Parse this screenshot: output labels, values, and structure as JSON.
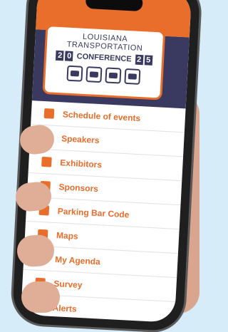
{
  "logo": {
    "title": "LOUISIANA TRANSPORTATION",
    "digits_left": [
      "2",
      "0"
    ],
    "conference": "CONFERENCE",
    "digits_right": [
      "2",
      "5"
    ]
  },
  "menu": [
    {
      "label": "Schedule of events",
      "icon": "calendar-icon"
    },
    {
      "label": "Speakers",
      "icon": "microphone-icon"
    },
    {
      "label": "Exhibitors",
      "icon": "briefcase-icon"
    },
    {
      "label": "Sponsors",
      "icon": "person-icon"
    },
    {
      "label": "Parking Bar Code",
      "icon": "clipboard-icon"
    },
    {
      "label": "Maps",
      "icon": "map-icon"
    },
    {
      "label": "My Agenda",
      "icon": "calendar-icon"
    },
    {
      "label": "Survey",
      "icon": "checkbox-icon"
    },
    {
      "label": "Alerts",
      "icon": "bell-icon"
    }
  ],
  "colors": {
    "accent": "#e96d2b",
    "header": "#3a3a60",
    "background": "#d7ecf9"
  }
}
